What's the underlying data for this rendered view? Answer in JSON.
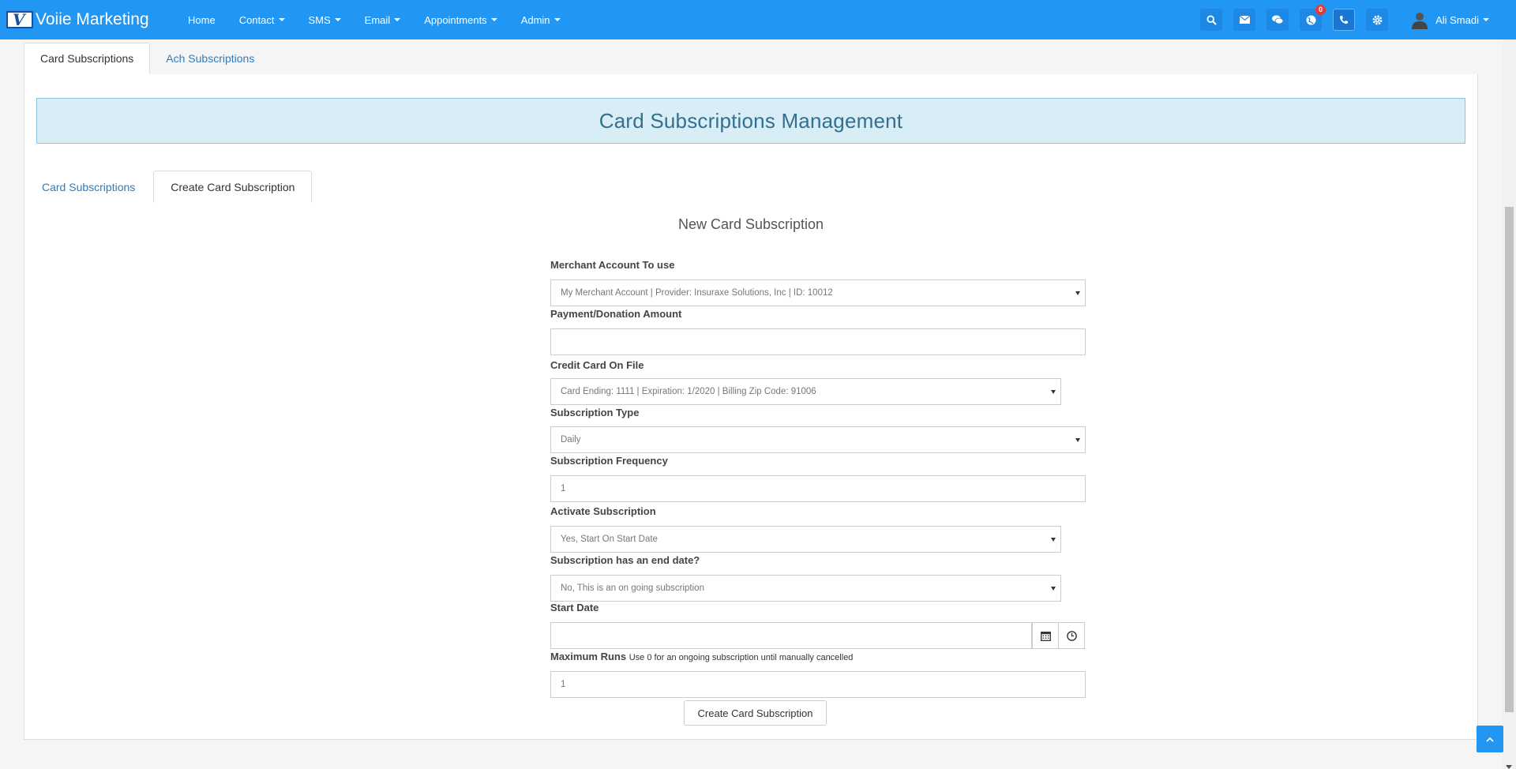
{
  "navbar": {
    "brand": "Voiie Marketing",
    "menu": [
      {
        "label": "Home",
        "dropdown": false
      },
      {
        "label": "Contact",
        "dropdown": true
      },
      {
        "label": "SMS",
        "dropdown": true
      },
      {
        "label": "Email",
        "dropdown": true
      },
      {
        "label": "Appointments",
        "dropdown": true
      },
      {
        "label": "Admin",
        "dropdown": true
      }
    ],
    "icons": [
      "search-icon",
      "envelope-icon",
      "chat-icon",
      "globe-icon",
      "phone-icon",
      "gear-icon"
    ],
    "notification_count": "0",
    "user_name": "Ali Smadi",
    "color": "#2196f3"
  },
  "outer_tabs": {
    "card": "Card Subscriptions",
    "ach": "Ach Subscriptions"
  },
  "header": {
    "title": "Card Subscriptions Management"
  },
  "inner_tabs": {
    "list": "Card Subscriptions",
    "create": "Create Card Subscription"
  },
  "form": {
    "title": "New Card Subscription",
    "merchant": {
      "label": "Merchant Account To use",
      "value": "My Merchant Account | Provider: Insuraxe Solutions, Inc | ID: 10012"
    },
    "amount": {
      "label": "Payment/Donation Amount",
      "value": ""
    },
    "card": {
      "label": "Credit Card On File",
      "value": "Card Ending: 1111 | Expiration: 1/2020 | Billing Zip Code: 91006"
    },
    "type": {
      "label": "Subscription Type",
      "value": "Daily"
    },
    "frequency": {
      "label": "Subscription Frequency",
      "value": "1"
    },
    "activate": {
      "label": "Activate Subscription",
      "value": "Yes, Start On Start Date"
    },
    "end_date": {
      "label": "Subscription has an end date?",
      "value": "No, This is an on going subscription"
    },
    "start_date": {
      "label": "Start Date",
      "value": ""
    },
    "max_runs": {
      "label": "Maximum Runs",
      "hint": "Use 0 for an ongoing subscription until manually cancelled",
      "value": "1"
    },
    "submit_label": "Create Card Subscription"
  }
}
